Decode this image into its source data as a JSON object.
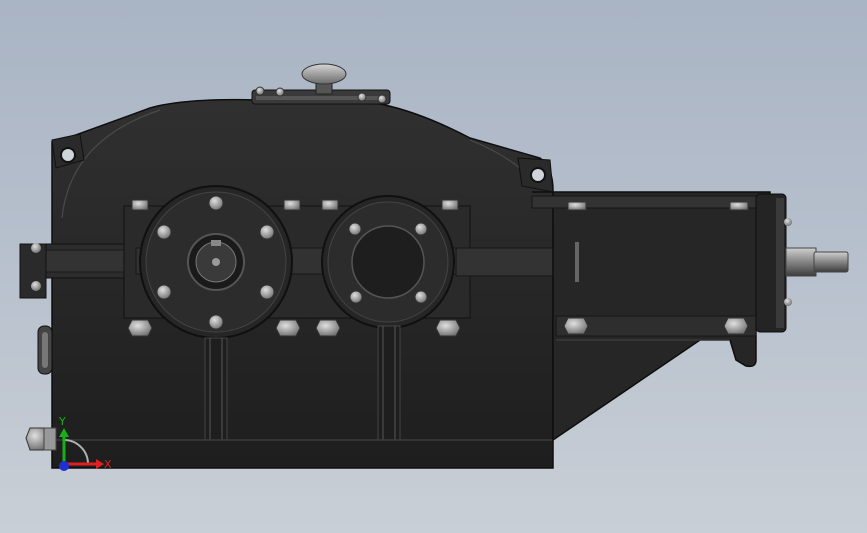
{
  "view": {
    "background_top": "#a9b4c4",
    "background_bottom": "#c9cfd6",
    "model_color": "#262626",
    "edge_color": "#111111",
    "highlight_color": "#5a5a5a"
  },
  "triad": {
    "x_label": "X",
    "y_label": "Y",
    "x_color": "#e02020",
    "y_color": "#18b018",
    "z_color": "#2030d0"
  }
}
